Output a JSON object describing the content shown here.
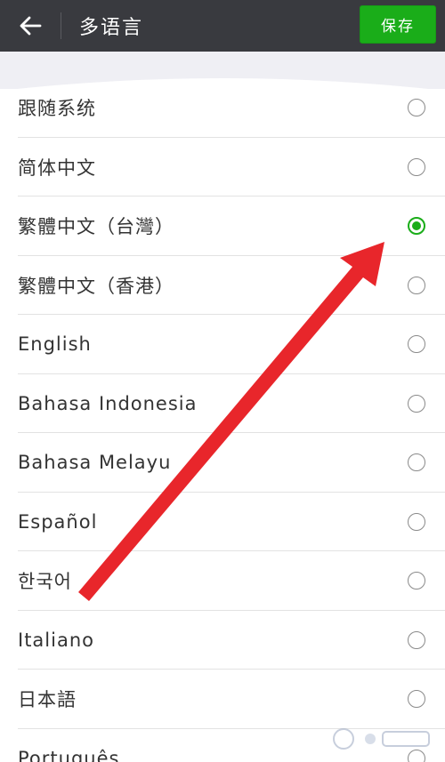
{
  "header": {
    "back_icon": "arrow-left-icon",
    "title": "多语言",
    "save_label": "保存"
  },
  "languages": [
    {
      "label": "跟随系统",
      "selected": false
    },
    {
      "label": "简体中文",
      "selected": false
    },
    {
      "label": "繁體中文（台灣）",
      "selected": true
    },
    {
      "label": "繁體中文（香港）",
      "selected": false
    },
    {
      "label": "English",
      "selected": false
    },
    {
      "label": "Bahasa Indonesia",
      "selected": false
    },
    {
      "label": "Bahasa Melayu",
      "selected": false
    },
    {
      "label": "Español",
      "selected": false
    },
    {
      "label": "한국어",
      "selected": false
    },
    {
      "label": "Italiano",
      "selected": false
    },
    {
      "label": "日本語",
      "selected": false
    },
    {
      "label": "Português",
      "selected": false
    }
  ],
  "colors": {
    "header_bg": "#393a3f",
    "accent": "#1aad19",
    "annotation_arrow": "#e8262b"
  }
}
